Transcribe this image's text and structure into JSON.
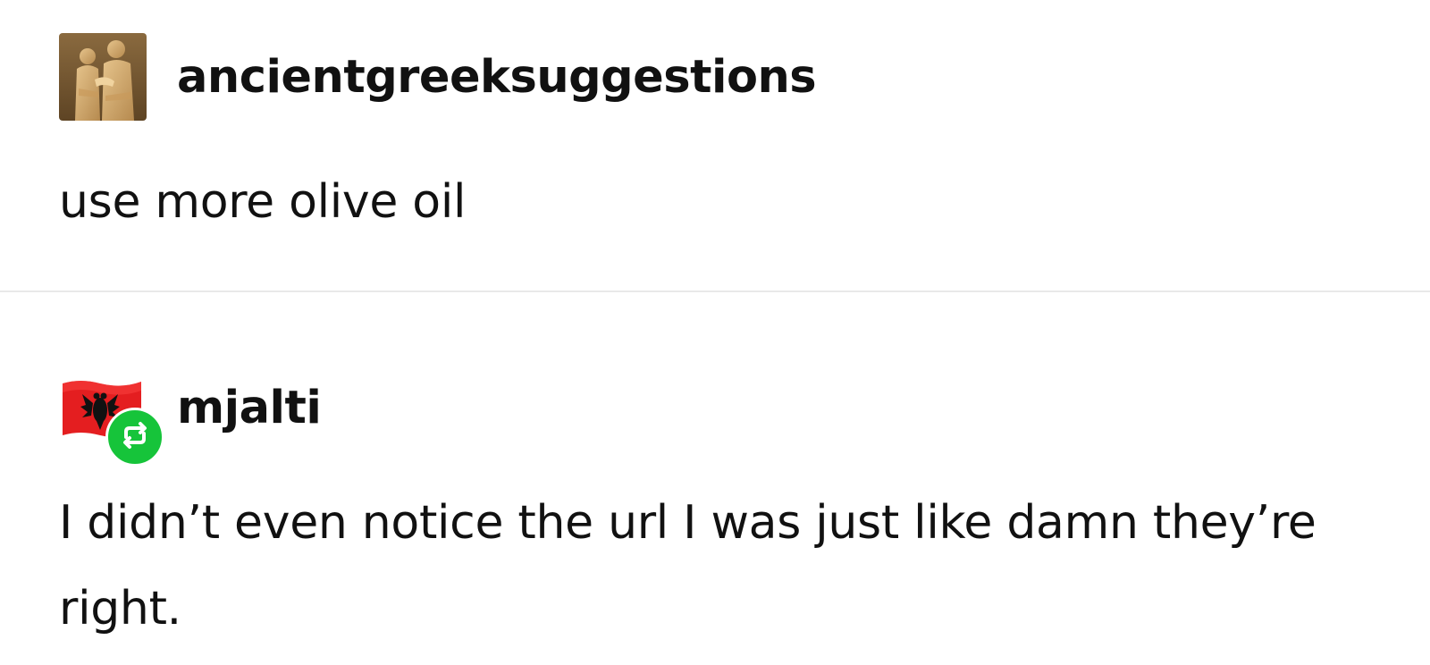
{
  "posts": [
    {
      "username": "ancientgreeksuggestions",
      "avatar_icon": "statue-avatar-icon",
      "text": "use more olive oil",
      "reblog": false
    },
    {
      "username": "mjalti",
      "avatar_icon": "albanian-flag-icon",
      "text": "I didn’t even notice the url I was just like damn they’re right.",
      "reblog": true,
      "reblog_badge_color": "#16c43a"
    }
  ],
  "colors": {
    "text": "#111111",
    "divider": "#e9e9e9",
    "reblog_green": "#16c43a",
    "flag_red": "#e41e20"
  }
}
